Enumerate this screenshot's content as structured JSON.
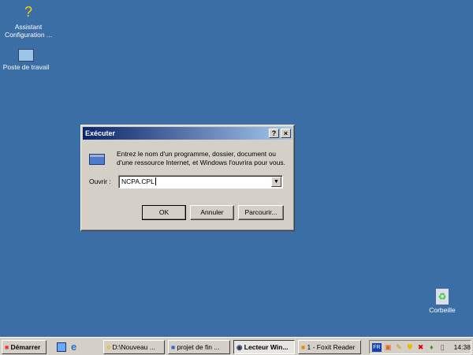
{
  "desktop": {
    "icons": [
      {
        "label": "Assistant Configuration ...",
        "icon": "wizard-icon"
      },
      {
        "label": "Poste de travail",
        "icon": "computer-icon"
      },
      {
        "label": "Corbeille",
        "icon": "recycle-bin-icon"
      }
    ]
  },
  "dialog": {
    "title": "Exécuter",
    "help": "?",
    "close": "×",
    "description": "Entrez le nom d'un programme, dossier, document ou d'une ressource Internet, et Windows l'ouvrira pour vous.",
    "open_label": "Ouvrir :",
    "open_value": "NCPA.CPL",
    "ok": "OK",
    "cancel": "Annuler",
    "browse": "Parcourir..."
  },
  "taskbar": {
    "start": "Démarrer",
    "items": [
      "D:\\Nouveau ...",
      "projet de fin ...",
      "Lecteur Win...",
      "1 - Foxit Reader"
    ],
    "lang": "FR",
    "clock": "14:38"
  },
  "colors": {
    "desktop": "#3a6ea5",
    "title_active": "#0a246a"
  }
}
